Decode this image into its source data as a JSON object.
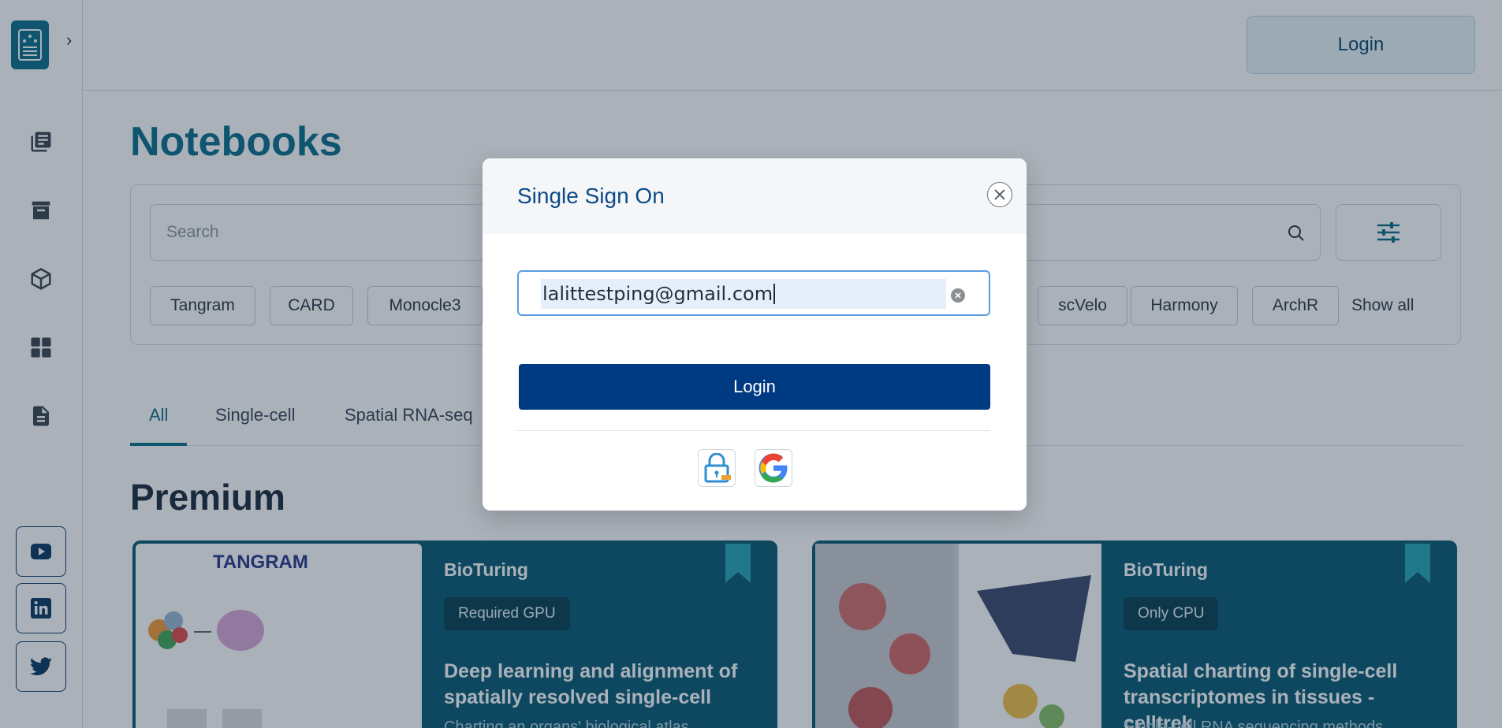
{
  "header": {
    "login_label": "Login"
  },
  "page": {
    "title": "Notebooks"
  },
  "search": {
    "placeholder": "Search"
  },
  "chips": [
    "Tangram",
    "CARD",
    "Monocle3",
    "scVelo",
    "Harmony",
    "ArchR"
  ],
  "show_all_label": "Show all",
  "tabs": [
    "All",
    "Single-cell",
    "Spatial RNA-seq"
  ],
  "section": {
    "title": "Premium"
  },
  "cards": [
    {
      "brand": "BioTuring",
      "badge": "Required GPU",
      "title": "Deep learning and alignment of spatially resolved single-cell",
      "subtitle": "Charting an organs' biological atlas",
      "image_label": "TANGRAM"
    },
    {
      "brand": "BioTuring",
      "badge": "Only CPU",
      "title": "Spatial charting of single-cell transcriptomes in tissues - celltrek",
      "subtitle": "Single-cell RNA sequencing methods"
    }
  ],
  "modal": {
    "title": "Single Sign On",
    "email_value": "lalittestping@gmail.com",
    "login_label": "Login"
  },
  "colors": {
    "accent": "#0e6f8e",
    "login_button": "#003a82",
    "card_bg": "#0b5b74"
  },
  "icons": {
    "sidebar": [
      "library-icon",
      "archive-icon",
      "cube-icon",
      "grid-icon",
      "document-icon"
    ],
    "social": [
      "youtube-icon",
      "linkedin-icon",
      "twitter-icon"
    ]
  }
}
